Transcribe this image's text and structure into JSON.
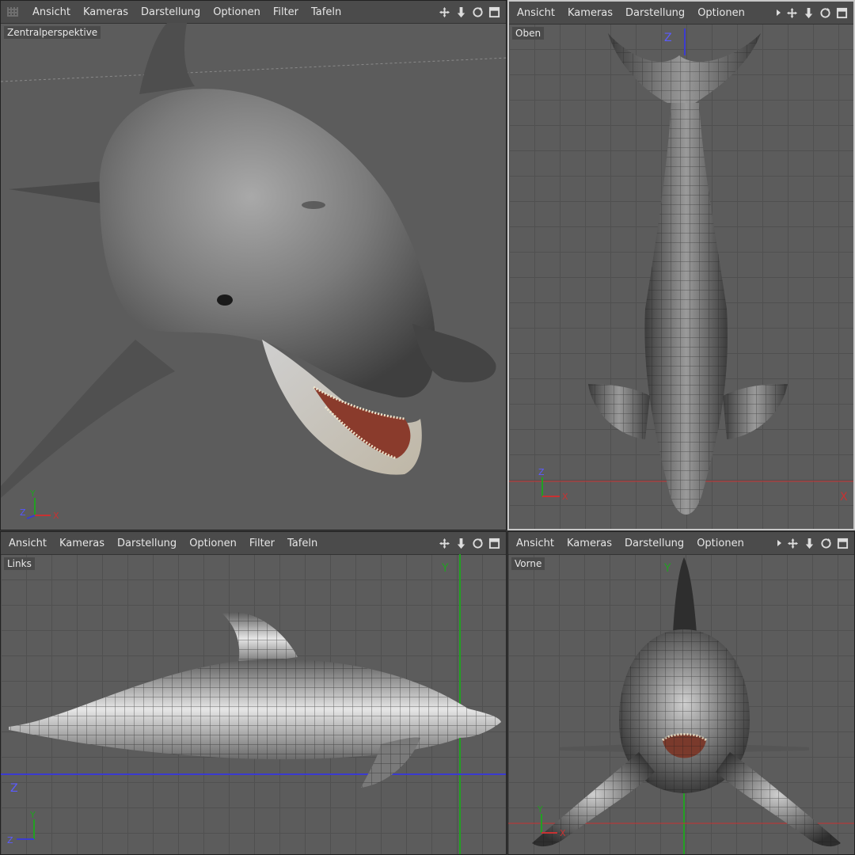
{
  "menus": {
    "full": [
      "Ansicht",
      "Kameras",
      "Darstellung",
      "Optionen",
      "Filter",
      "Tafeln"
    ],
    "short": [
      "Ansicht",
      "Kameras",
      "Darstellung",
      "Optionen"
    ]
  },
  "viewports": {
    "top_left": {
      "label": "Zentralperspektive"
    },
    "top_right": {
      "label": "Oben",
      "axis_vertical": "Z",
      "axis_horizontal": "X"
    },
    "bottom_left": {
      "label": "Links",
      "axis_vertical": "Y",
      "axis_horizontal": "Z"
    },
    "bottom_right": {
      "label": "Vorne",
      "axis_vertical": "Y"
    }
  },
  "gizmo": {
    "y": "Y",
    "z": "Z",
    "x": "X"
  },
  "icons": [
    "move-icon",
    "scale-arrow-icon",
    "rotate-icon",
    "maximize-icon",
    "expand-arrow-icon"
  ],
  "colors": {
    "panel_bg": "#5c5c5c",
    "menubar_bg": "#4b4b4b",
    "axis_x": "#c83232",
    "axis_y": "#22a022",
    "axis_z": "#3b3bd0",
    "active_border": "#c8c8c8"
  }
}
